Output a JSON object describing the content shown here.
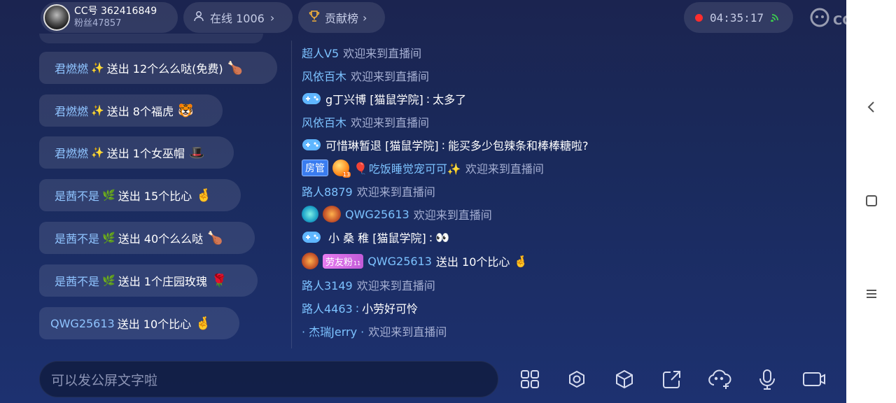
{
  "anchor": {
    "id_label": "CC号 362416849",
    "fans_label": "粉丝47857"
  },
  "online": {
    "label": "在线 1006",
    "chevron": "›"
  },
  "rank": {
    "label": "贡献榜",
    "chevron": "›"
  },
  "timer": {
    "time": "04:35:17"
  },
  "watermark": {
    "text": "CC直播"
  },
  "gifts": [
    {
      "user": "君燃燃",
      "emoji": "✨",
      "text": "送出 12个么么哒(免费)",
      "gift": "🍗"
    },
    {
      "user": "君燃燃",
      "emoji": "✨",
      "text": "送出 8个福虎",
      "gift": "🐯"
    },
    {
      "user": "君燃燃",
      "emoji": "✨",
      "text": "送出 1个女巫帽",
      "gift": "🎩"
    },
    {
      "user": "是茜不是",
      "emoji": "🌿",
      "text": "送出 15个比心",
      "gift": "🤞"
    },
    {
      "user": "是茜不是",
      "emoji": "🌿",
      "text": "送出 40个么么哒",
      "gift": "🍗"
    },
    {
      "user": "是茜不是",
      "emoji": "🌿",
      "text": "送出 1个庄园玫瑰",
      "gift": "🌹"
    },
    {
      "user": "QWG25613",
      "emoji": "",
      "text": "送出 10个比心",
      "gift": "🤞"
    }
  ],
  "chat": {
    "l1": {
      "name": "超人V5",
      "text": "欢迎来到直播间"
    },
    "l2": {
      "name": "风依百木",
      "text": "欢迎来到直播间"
    },
    "l3": {
      "name": "g丁兴博 [猫鼠学院]",
      "sep": ":",
      "text": "太多了"
    },
    "l4": {
      "name": "风依百木",
      "text": "欢迎来到直播间"
    },
    "l5": {
      "name": "可惜琳暂退 [猫鼠学院]",
      "sep": ":",
      "text": "能买多少包辣条和棒棒糖啦?"
    },
    "l6": {
      "badge": "房管",
      "level": "13",
      "balloon": "🎈",
      "name": "吃饭睡觉宠可可✨",
      "text": "欢迎来到直播间"
    },
    "l7": {
      "name": "路人8879",
      "text": "欢迎来到直播间"
    },
    "l8": {
      "name": "QWG25613",
      "text": "欢迎来到直播间"
    },
    "l9": {
      "name": "小 桑 稚 [猫鼠学院]",
      "sep": ":",
      "text": "👀"
    },
    "l10": {
      "fan_badge": "劳友粉",
      "fan_level": "11",
      "name": "QWG25613",
      "text": "送出 10个比心",
      "gift": "🤞"
    },
    "l11": {
      "name": "路人3149",
      "text": "欢迎来到直播间"
    },
    "l12": {
      "name": "路人4463",
      "sep": ":",
      "text": "小劳好可怜"
    },
    "l13": {
      "name": "· 杰瑞Jerry ·",
      "text": "欢迎来到直播间"
    }
  },
  "input": {
    "placeholder": "可以发公屏文字啦"
  },
  "tools": [
    "apps-icon",
    "settings-icon",
    "box-icon",
    "share-icon",
    "cloud-add-icon",
    "mic-icon",
    "camera-icon"
  ],
  "colors": {
    "name_blue": "#7cc2ff",
    "welcome_gray": "#a6b0d3",
    "admin_badge": "#3a7cf0",
    "rec_red": "#ff2d2d"
  }
}
